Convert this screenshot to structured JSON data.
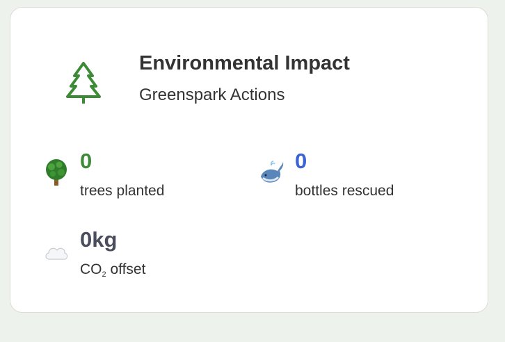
{
  "card": {
    "title": "Environmental Impact",
    "subtitle": "Greenspark Actions",
    "icon": "pine-tree-outline-icon"
  },
  "stats": {
    "trees": {
      "value": "0",
      "label": "trees planted",
      "icon": "deciduous-tree-icon",
      "color": "#3d8b37"
    },
    "bottles": {
      "value": "0",
      "label": "bottles rescued",
      "icon": "whale-icon",
      "color": "#3b63d6"
    },
    "co2": {
      "value": "0kg",
      "label_main": "CO",
      "label_sub": "2",
      "label_rest": " offset",
      "icon": "cloud-icon",
      "color": "#4a4d5c"
    }
  },
  "colors": {
    "page_background": "#eef2ec",
    "card_background": "#ffffff",
    "brand_green": "#3d8b37"
  }
}
